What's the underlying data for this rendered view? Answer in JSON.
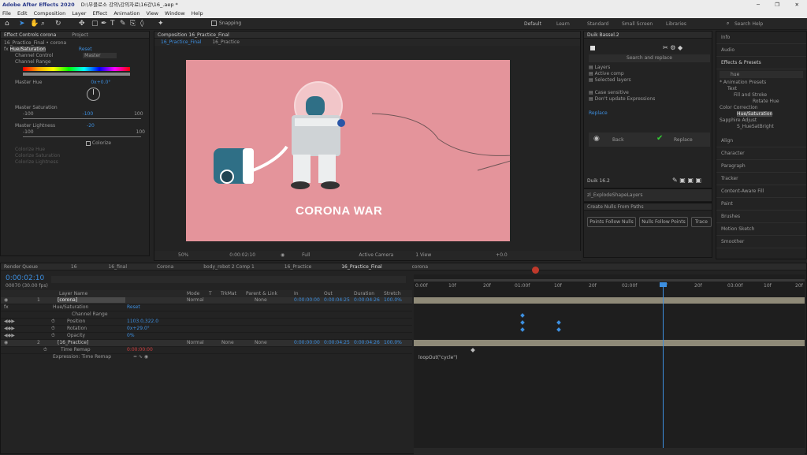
{
  "titlebar": {
    "app_title": "Adobe After Effects 2020",
    "file_title": "D:\\부클로소 강의\\강의자료\\16강\\16_.aep *"
  },
  "menu": [
    "File",
    "Edit",
    "Composition",
    "Layer",
    "Effect",
    "Animation",
    "View",
    "Window",
    "Help"
  ],
  "toolbar": {
    "snapping": "Snapping",
    "workspaces": [
      "Default",
      "Learn",
      "Standard",
      "Small Screen",
      "Libraries"
    ],
    "search_placeholder": "Search Help"
  },
  "effect_controls": {
    "tab": "Effect Controls corona",
    "project_tab": "Project",
    "comp_line": "16_Practice_Final • corona",
    "effect_name": "Hue/Saturation",
    "reset": "Reset",
    "channel_control_label": "Channel Control",
    "channel_control_value": "Master",
    "channel_range": "Channel Range",
    "master_hue_label": "Master Hue",
    "master_hue_value": "0x+0.0°",
    "master_sat_label": "Master Saturation",
    "master_sat_value": "-100",
    "sat_min": "-100",
    "sat_max": "100",
    "master_light_label": "Master Lightness",
    "master_light_value": "-20",
    "light_min": "-100",
    "light_max": "100",
    "colorize": "Colorize",
    "colorize_hue": "Colorize Hue",
    "colorize_sat": "Colorize Saturation",
    "colorize_light": "Colorize Lightness"
  },
  "composition": {
    "tab": "Composition 16_Practice_Final",
    "subtabs": [
      "16_Practice_Final",
      "16_Practice"
    ],
    "title_text": "CORONA WAR",
    "zoom": "50%",
    "timecode": "0:00:02:10",
    "resolution": "Full",
    "camera": "Active Camera",
    "view": "1 View",
    "exposure": "+0.0"
  },
  "duik": {
    "tab": "Duik Bassel.2",
    "search": "Search and replace",
    "opts": [
      "Layers",
      "Active comp",
      "Selected layers",
      "Case sensitive",
      "Don't update Expressions"
    ],
    "replace": "Replace",
    "back": "Back",
    "replace_btn": "Replace",
    "version": "Duik 16.2",
    "explode": "zl_ExplodeShapeLayers",
    "nulls_title": "Create Nulls From Paths",
    "nulls_btns": [
      "Points Follow Nulls",
      "Nulls Follow Points",
      "Trace Path"
    ]
  },
  "right_panel": {
    "items_top": [
      "Info",
      "Audio"
    ],
    "effects_presets": "Effects & Presets",
    "search_value": "hue",
    "tree": [
      "* Animation Presets",
      "Text",
      "Fill and Stroke",
      "Rotate Hue",
      "Color Correction",
      "Hue/Saturation",
      "Sapphire Adjust",
      "S_HueSatBright"
    ],
    "items_bottom": [
      "Align",
      "Character",
      "Paragraph",
      "Tracker",
      "Content-Aware Fill",
      "Paint",
      "Brushes",
      "Motion Sketch",
      "Smoother"
    ]
  },
  "timeline": {
    "tabs": [
      "Render Queue",
      "16",
      "16_final",
      "Corona",
      "body_robot 2 Comp 1",
      "16_Practice",
      "16_Practice_Final",
      "corona"
    ],
    "timecode": "0:00:02:10",
    "frames": "00070 (30.00 fps)",
    "columns": [
      "Layer Name",
      "Mode",
      "T",
      "TrkMat",
      "Parent & Link",
      "In",
      "Out",
      "Duration",
      "Stretch"
    ],
    "layer1": {
      "num": "1",
      "name": "[corona]",
      "mode": "Normal",
      "parent": "None",
      "in": "0:00:00:00",
      "out": "0:00:04:25",
      "duration": "0:00:04:26",
      "stretch": "100.0%"
    },
    "effect_row": "Hue/Saturation",
    "effect_reset": "Reset",
    "channel_range": "Channel Range",
    "props": [
      {
        "name": "Position",
        "value": "1103.0,322.0"
      },
      {
        "name": "Rotation",
        "value": "0x+29.0°"
      },
      {
        "name": "Opacity",
        "value": "0%"
      }
    ],
    "layer2": {
      "num": "2",
      "name": "[16_Practice]",
      "mode": "Normal",
      "trkmat": "None",
      "parent": "None",
      "in": "0:00:00:00",
      "out": "0:00:04:25",
      "duration": "0:00:04:26",
      "stretch": "100.0%"
    },
    "time_remap": "Time Remap",
    "time_remap_value": "0:00:00:00",
    "expr_label": "Expression: Time Remap",
    "expression": "loopOut(\"cycle\")",
    "ruler": [
      "0:00f",
      "10f",
      "20f",
      "01:00f",
      "10f",
      "20f",
      "02:00f",
      "10f",
      "20f",
      "03:00f",
      "10f",
      "20f",
      "04:00f"
    ]
  },
  "colors": {
    "canvas_bg": "#e4949b",
    "accent": "#3d8fe0",
    "title_white": "#ffffff"
  }
}
